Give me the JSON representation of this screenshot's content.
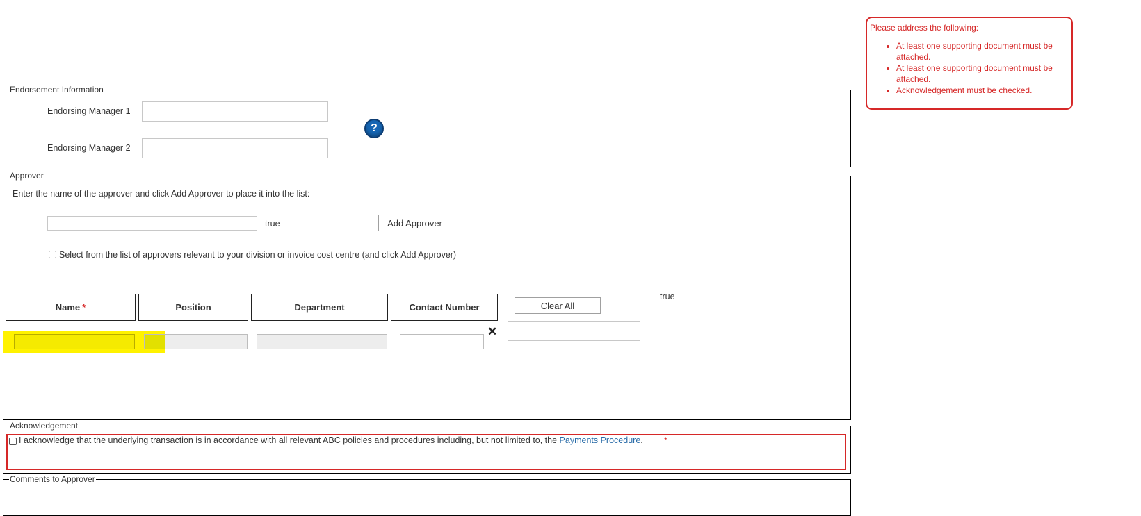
{
  "endorsement": {
    "legend": "Endorsement Information",
    "manager1_label": "Endorsing Manager 1",
    "manager2_label": "Endorsing Manager 2",
    "manager1_value": "",
    "manager2_value": "",
    "help_icon_glyph": "?"
  },
  "approver": {
    "legend": "Approver",
    "instructions": "Enter the name of the approver and click Add Approver to place it into the list:",
    "name_input_value": "",
    "name_input_flag": "true",
    "add_button_label": "Add Approver",
    "select_list_label": "Select from the list of approvers relevant to your division or invoice cost centre (and click Add Approver)",
    "table_headers": {
      "name": "Name",
      "position": "Position",
      "department": "Department",
      "contact": "Contact Number"
    },
    "required_marker": "*",
    "clear_all_label": "Clear All",
    "table_flag": "true",
    "remove_glyph": "✕",
    "highlight_color": "#fff200"
  },
  "acknowledgement": {
    "legend": "Acknowledgement",
    "text": "I  acknowledge that the underlying transaction is in accordance with all relevant ABC policies and procedures including, but not limited to, the ",
    "link_text": "Payments Procedure",
    "text_end": ".",
    "required_marker": "*"
  },
  "comments": {
    "legend": "Comments to Approver"
  },
  "validation": {
    "heading": "Please address the following:",
    "errors": [
      "At least one supporting document must be attached.",
      "At least one supporting document must be attached.",
      "Acknowledgement must be checked."
    ],
    "color": "#d62828"
  }
}
